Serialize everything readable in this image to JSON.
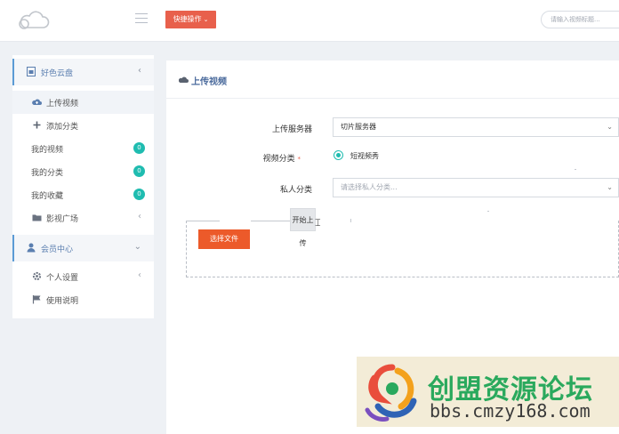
{
  "topbar": {
    "quick_label": "快捷操作",
    "search_placeholder": "请输入视频标题..."
  },
  "sidebar": {
    "group1_label": "好色云盘",
    "items": [
      {
        "label": "上传视频",
        "icon": "cloud-upload-icon"
      },
      {
        "label": "添加分类",
        "icon": "plus-icon"
      },
      {
        "label": "我的视频",
        "badge": "0"
      },
      {
        "label": "我的分类",
        "badge": "0"
      },
      {
        "label": "我的收藏",
        "badge": "0"
      },
      {
        "label": "影视广场",
        "icon": "folder-icon"
      }
    ],
    "group2_label": "会员中心",
    "items2": [
      {
        "label": "个人设置",
        "icon": "gear-icon"
      },
      {
        "label": "使用说明",
        "icon": "flag-icon"
      }
    ]
  },
  "main": {
    "title": "上传视频",
    "server_label": "上传服务器",
    "server_value": "切片服务器",
    "category_label": "视频分类",
    "category_required": "*",
    "category_option": "短视频秀",
    "private_label": "私人分类",
    "private_placeholder": "请选择私人分类...",
    "choose_file": "选择文件",
    "start_upload": "开始上传"
  },
  "watermark": {
    "name": "创盟资源论坛",
    "url": "bbs.cmzy168.com"
  },
  "colors": {
    "accent_red": "#e8604c",
    "teal": "#1fbcb0",
    "link_blue": "#4a6a9c",
    "watermark_green": "#2aa95d"
  }
}
